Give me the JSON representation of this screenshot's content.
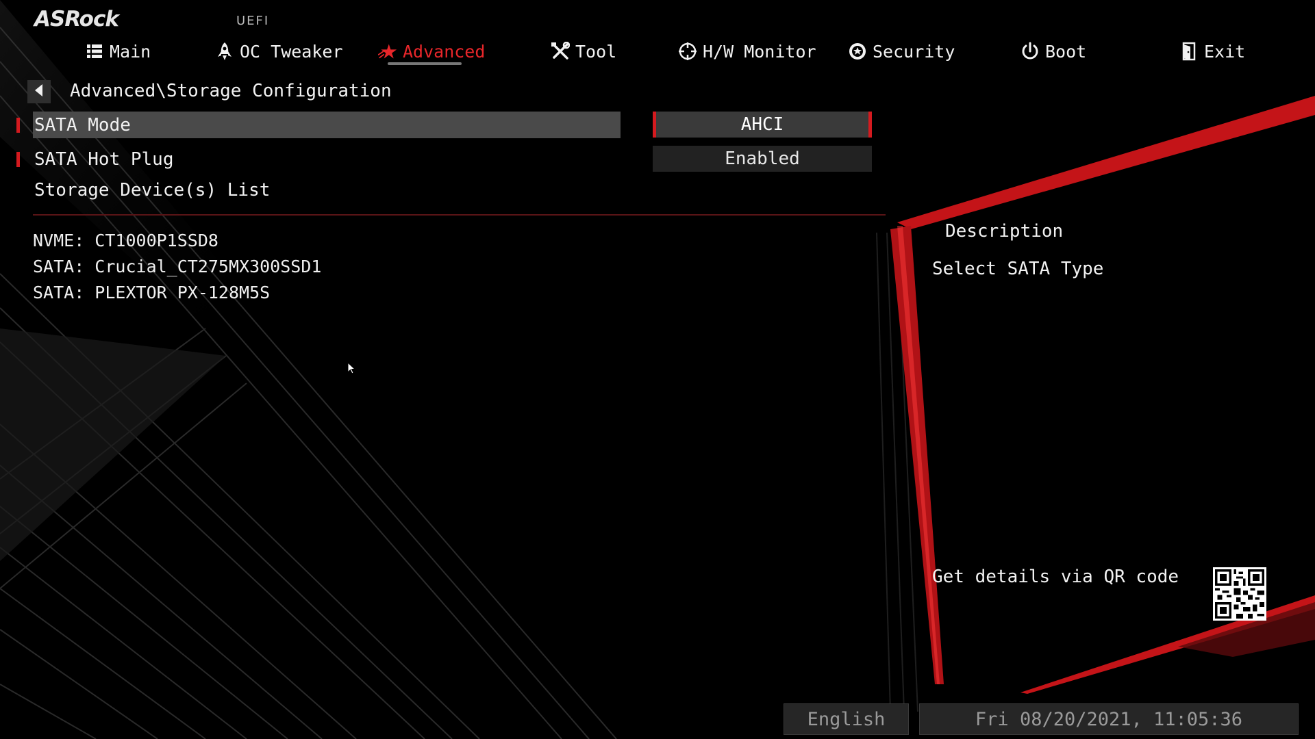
{
  "brand": {
    "logo_text": "ASRock",
    "firmware_tag": "UEFI"
  },
  "nav": {
    "items": [
      {
        "label": "Main",
        "icon": "list-icon"
      },
      {
        "label": "OC Tweaker",
        "icon": "rocket-icon"
      },
      {
        "label": "Advanced",
        "icon": "star-icon",
        "active": true
      },
      {
        "label": "Tool",
        "icon": "tools-icon"
      },
      {
        "label": "H/W Monitor",
        "icon": "crosshair-icon"
      },
      {
        "label": "Security",
        "icon": "shield-icon"
      },
      {
        "label": "Boot",
        "icon": "power-icon"
      },
      {
        "label": "Exit",
        "icon": "exit-door-icon"
      }
    ]
  },
  "breadcrumb": "Advanced\\Storage Configuration",
  "settings": [
    {
      "label": "SATA Mode",
      "value": "AHCI",
      "selected": true
    },
    {
      "label": "SATA Hot Plug",
      "value": "Enabled"
    },
    {
      "label": "Storage Device(s) List"
    }
  ],
  "devices": [
    "NVME: CT1000P1SSD8",
    "SATA: Crucial_CT275MX300SSD1",
    "SATA: PLEXTOR PX-128M5S"
  ],
  "description": {
    "title": "Description",
    "text": "Select SATA Type",
    "qr_prompt": "Get details via QR code"
  },
  "footer": {
    "language": "English",
    "datetime": "Fri 08/20/2021, 11:05:36"
  },
  "colors": {
    "accent": "#d41a1f",
    "background": "#000000",
    "highlight": "#4a4a4a"
  }
}
